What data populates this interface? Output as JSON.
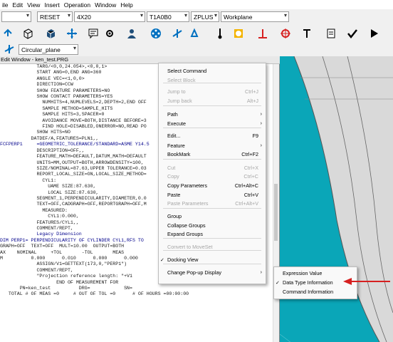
{
  "menubar": {
    "items": [
      "ile",
      "Edit",
      "View",
      "Insert",
      "Operation",
      "Window",
      "Help"
    ]
  },
  "selectors": {
    "blank": "",
    "reset": "RESET",
    "probe": "4X20",
    "tip": "T1A0B0",
    "zplus": "ZPLUS",
    "workplane": "Workplane"
  },
  "row4": {
    "plane": "Circular_plane"
  },
  "edit_window": {
    "title": "Edit Window - ken_test.PRG",
    "lines": [
      "             TARG/<0,0,24.054>,<0,0,1>",
      "             START ANG=0,END ANG=360",
      "             ANGLE VEC=<1,0,0>",
      "             DIRECTION=CCW",
      "             SHOW FEATURE PARAMETERS=NO",
      "             SHOW CONTACT PARAMETERS=YES",
      "               NUMHITS=4,NUMLEVELS=2,DEPTH=2,END OFF",
      "               SAMPLE METHOD=SAMPLE_HITS",
      "               SAMPLE HITS=3,SPACER=0",
      "               AVOIDANCE MOVE=BOTH,DISTANCE BEFORE=3",
      "               FIND HOLE=DISABLED,ONERROR=NO,READ PO",
      "             SHOW HITS=NO",
      "           DATDEF/A,FEATURES=PLN1,,",
      "FCFPERP1     =GEOMETRIC_TOLERANCE/STANDARD=ASME Y14.5",
      "             DESCRIPTION=OFF,,",
      "             FEATURE_MATH=DEFAULT,DATUM_MATH=DEFAULT",
      "             UNITS=MM,OUTPUT=BOTH,ARROWDENSITY=100,",
      "             SIZE/NOMINAL=87.63,UPPER TOLERANCE=0.03",
      "             REPORT_LOCAL_SIZE=ON,LOCAL_SIZE_METHOD=",
      "               CYL1:",
      "                 UAME SIZE:87.630,",
      "                 LOCAL SIZE:87.630,",
      "             SEGMENT_1,PERPENDICULARITY,DIAMETER,0.0",
      "             TEXT=OFF,CADGRAPH=OFF,REPORTGRAPH=OFF,M",
      "               MEASURED:",
      "                 CYL1:0.000,",
      "             FEATURES/CYL1,,",
      "             COMMENT/REPT,",
      "",
      "             Legacy Dimension",
      "",
      "DIM PERP1= PERPENDICULARITY OF CYLINDER CYL1,RFS TO",
      "GRAPH=OFF  TEXT=OFF  MULT=10.00  OUTPUT=BOTH",
      "AX    NOMINAL     +TOL       -TOL       MEAS",
      "M          0.000      0.010      0.000      0.000",
      "             ASSIGN/V1=GETTEXT(173,0,\"PERP1\")",
      "             COMMENT/REPT,",
      "             \"Projection reference length: \"+V1",
      "                    END OF MEASUREMENT FOR",
      "       PN=ken_test          DRG=            SN=",
      "   TOTAL # OF MEAS =0     # OUT OF TOL =0      # OF HOURS =00:00:00"
    ]
  },
  "context_menu": {
    "items": [
      {
        "label": "Select Command",
        "shortcut": "",
        "disabled": false,
        "submenu": false
      },
      {
        "label": "Select Block",
        "shortcut": "",
        "disabled": true,
        "submenu": false
      },
      {
        "label": "Jump to",
        "shortcut": "Ctrl+J",
        "disabled": true,
        "submenu": false
      },
      {
        "label": "Jump back",
        "shortcut": "Alt+J",
        "disabled": true,
        "submenu": false
      },
      {
        "label": "Path",
        "shortcut": "",
        "disabled": false,
        "submenu": true
      },
      {
        "label": "Execute",
        "shortcut": "",
        "disabled": false,
        "submenu": true
      },
      {
        "label": "Edit...",
        "shortcut": "F9",
        "disabled": false,
        "submenu": false
      },
      {
        "label": "Feature",
        "shortcut": "",
        "disabled": false,
        "submenu": true
      },
      {
        "label": "BookMark",
        "shortcut": "Ctrl+F2",
        "disabled": false,
        "submenu": false
      },
      {
        "label": "Cut",
        "shortcut": "Ctrl+X",
        "disabled": true,
        "submenu": false
      },
      {
        "label": "Copy",
        "shortcut": "Ctrl+C",
        "disabled": true,
        "submenu": false
      },
      {
        "label": "Copy Parameters",
        "shortcut": "Ctrl+Alt+C",
        "disabled": false,
        "submenu": false
      },
      {
        "label": "Paste",
        "shortcut": "Ctrl+V",
        "disabled": false,
        "submenu": false
      },
      {
        "label": "Paste Parameters",
        "shortcut": "Ctrl+Alt+V",
        "disabled": true,
        "submenu": false
      },
      {
        "label": "Group",
        "shortcut": "",
        "disabled": false,
        "submenu": false
      },
      {
        "label": "Collapse Groups",
        "shortcut": "",
        "disabled": false,
        "submenu": false
      },
      {
        "label": "Expand Groups",
        "shortcut": "",
        "disabled": false,
        "submenu": false
      },
      {
        "label": "Convert to MoveSet",
        "shortcut": "",
        "disabled": true,
        "submenu": false
      },
      {
        "label": "Docking View",
        "shortcut": "",
        "disabled": false,
        "submenu": false,
        "checked": true
      },
      {
        "label": "Change Pop-up Display",
        "shortcut": "",
        "disabled": false,
        "submenu": true
      }
    ]
  },
  "submenu": {
    "items": [
      {
        "label": "Expression Value",
        "checked": false
      },
      {
        "label": "Data Type Information",
        "checked": true
      },
      {
        "label": "Command Information",
        "checked": false
      }
    ]
  },
  "colors": {
    "viewport": "#0aa6b8",
    "part": "#e6e6e6",
    "arrow": "#d62020",
    "link": "#0000ee"
  }
}
